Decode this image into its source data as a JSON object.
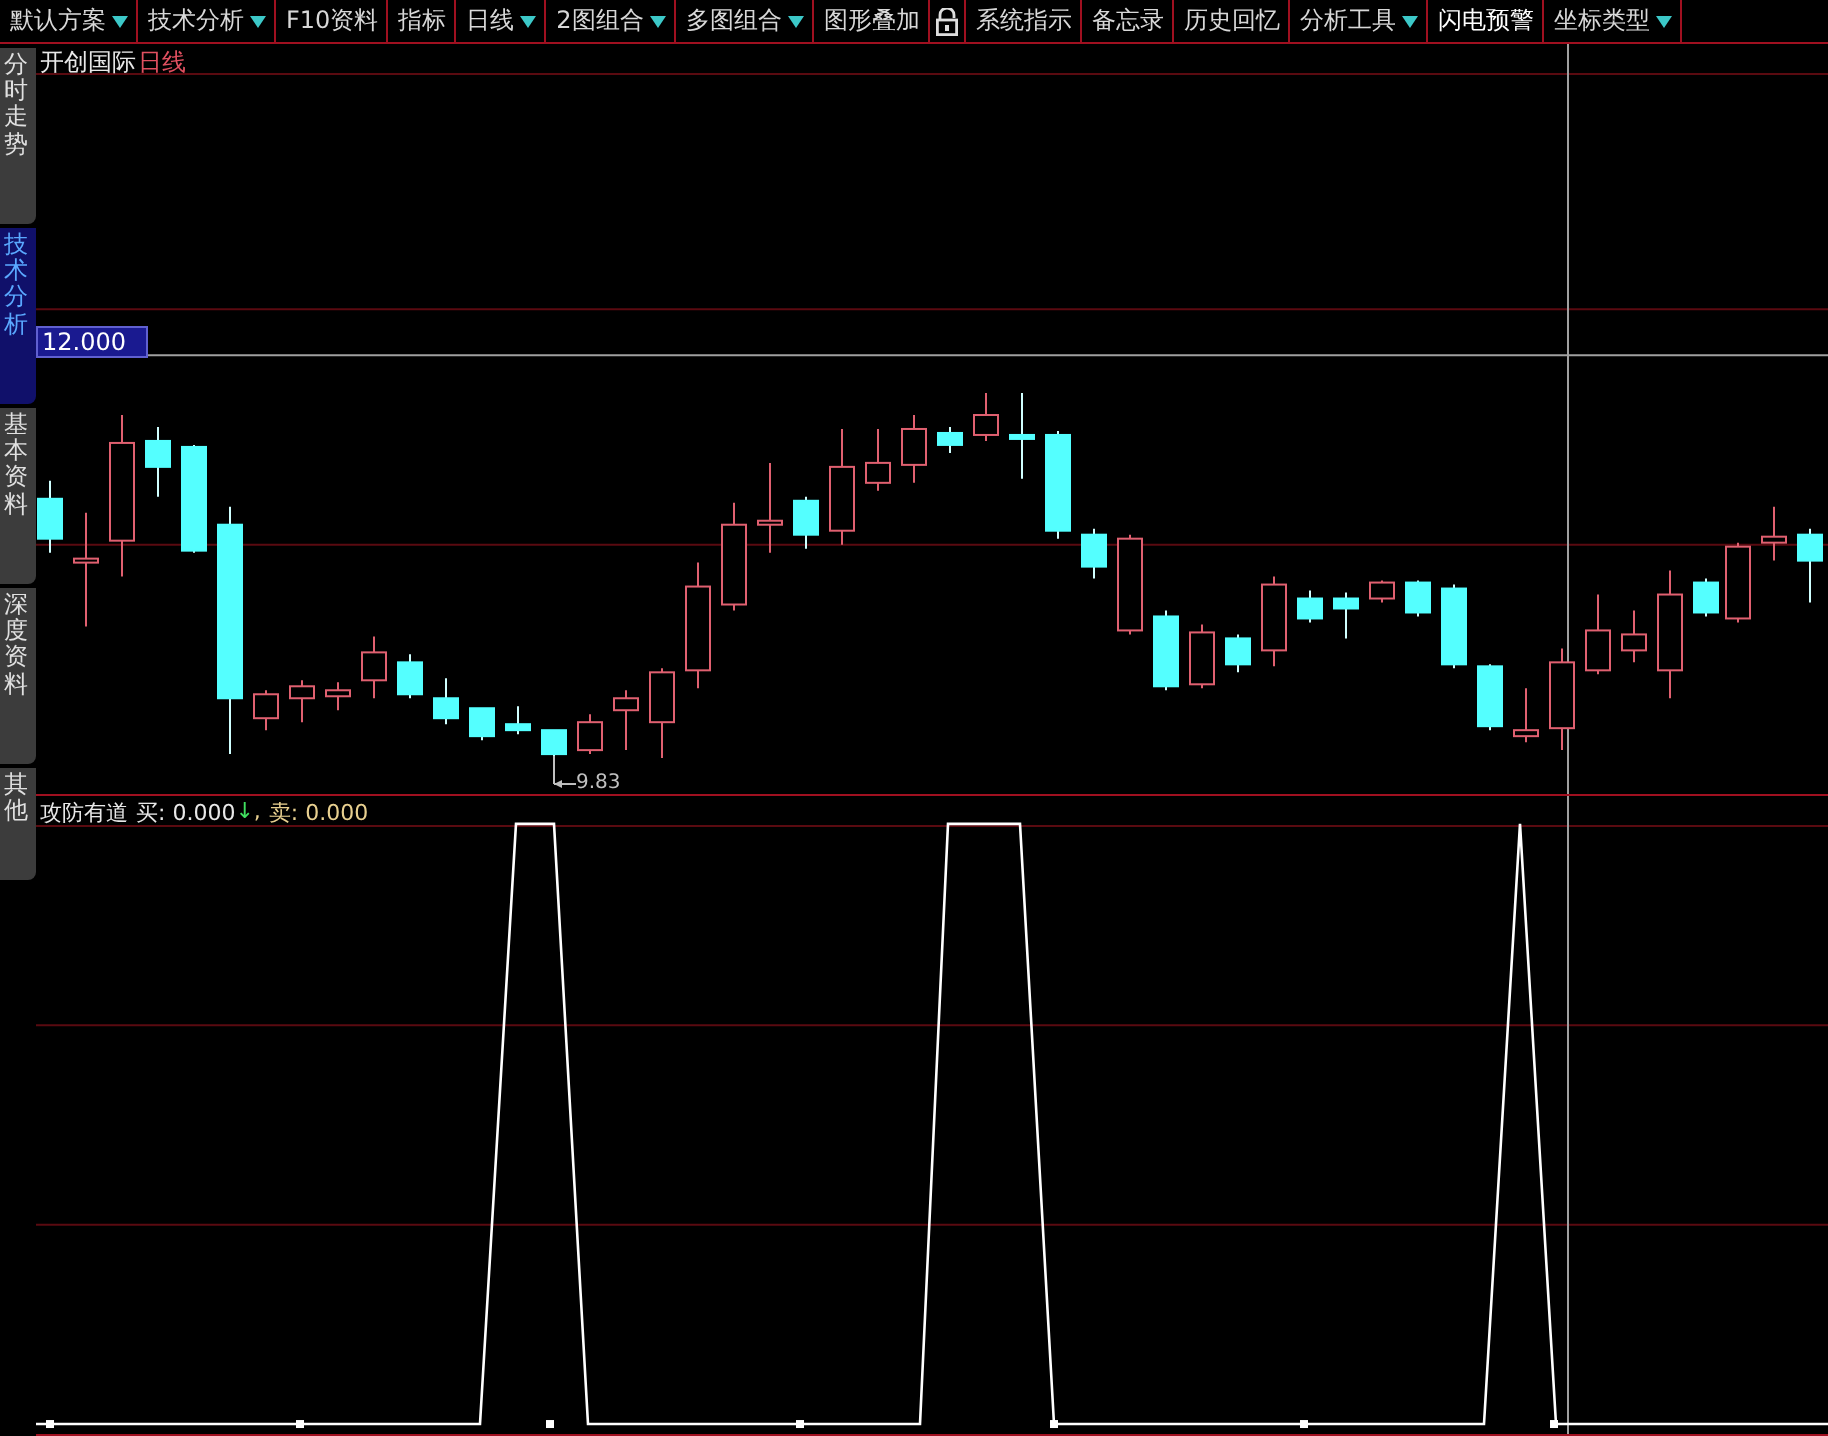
{
  "toolbar": [
    {
      "kind": "menu",
      "label": "默认方案",
      "dropdown": true,
      "highlighted": false
    },
    {
      "kind": "menu",
      "label": "技术分析",
      "dropdown": true,
      "highlighted": false
    },
    {
      "kind": "menu",
      "label": "F10资料",
      "dropdown": false,
      "highlighted": false
    },
    {
      "kind": "menu",
      "label": "指标",
      "dropdown": false,
      "highlighted": false
    },
    {
      "kind": "menu",
      "label": "日线",
      "dropdown": true,
      "highlighted": false
    },
    {
      "kind": "menu",
      "label": "2图组合",
      "dropdown": true,
      "highlighted": false
    },
    {
      "kind": "menu",
      "label": "多图组合",
      "dropdown": true,
      "highlighted": false
    },
    {
      "kind": "menu",
      "label": "图形叠加",
      "dropdown": false,
      "highlighted": false
    },
    {
      "kind": "lock"
    },
    {
      "kind": "menu",
      "label": "系统指示",
      "dropdown": false,
      "highlighted": false
    },
    {
      "kind": "menu",
      "label": "备忘录",
      "dropdown": false,
      "highlighted": false
    },
    {
      "kind": "menu",
      "label": "历史回忆",
      "dropdown": false,
      "highlighted": false
    },
    {
      "kind": "menu",
      "label": "分析工具",
      "dropdown": true,
      "highlighted": false
    },
    {
      "kind": "menu",
      "label": "闪电预警",
      "dropdown": false,
      "highlighted": true
    },
    {
      "kind": "menu",
      "label": "坐标类型",
      "dropdown": true,
      "highlighted": false
    }
  ],
  "side_tabs": [
    {
      "label": "分时走势",
      "selected": false
    },
    {
      "label": "技术分析",
      "selected": true
    },
    {
      "label": "基本资料",
      "selected": false
    },
    {
      "label": "深度资料",
      "selected": false
    },
    {
      "label": "其他",
      "selected": false
    }
  ],
  "chart": {
    "stock": "开创国际",
    "period": "日线",
    "crosshair_value": "12.000",
    "low_marker": "9.83"
  },
  "indicator": {
    "name": "攻防有道",
    "values": [
      {
        "text": "买: 0.000",
        "arrow": "↓"
      },
      {
        "text": "卖: 0.000"
      }
    ],
    "separator": ","
  }
}
